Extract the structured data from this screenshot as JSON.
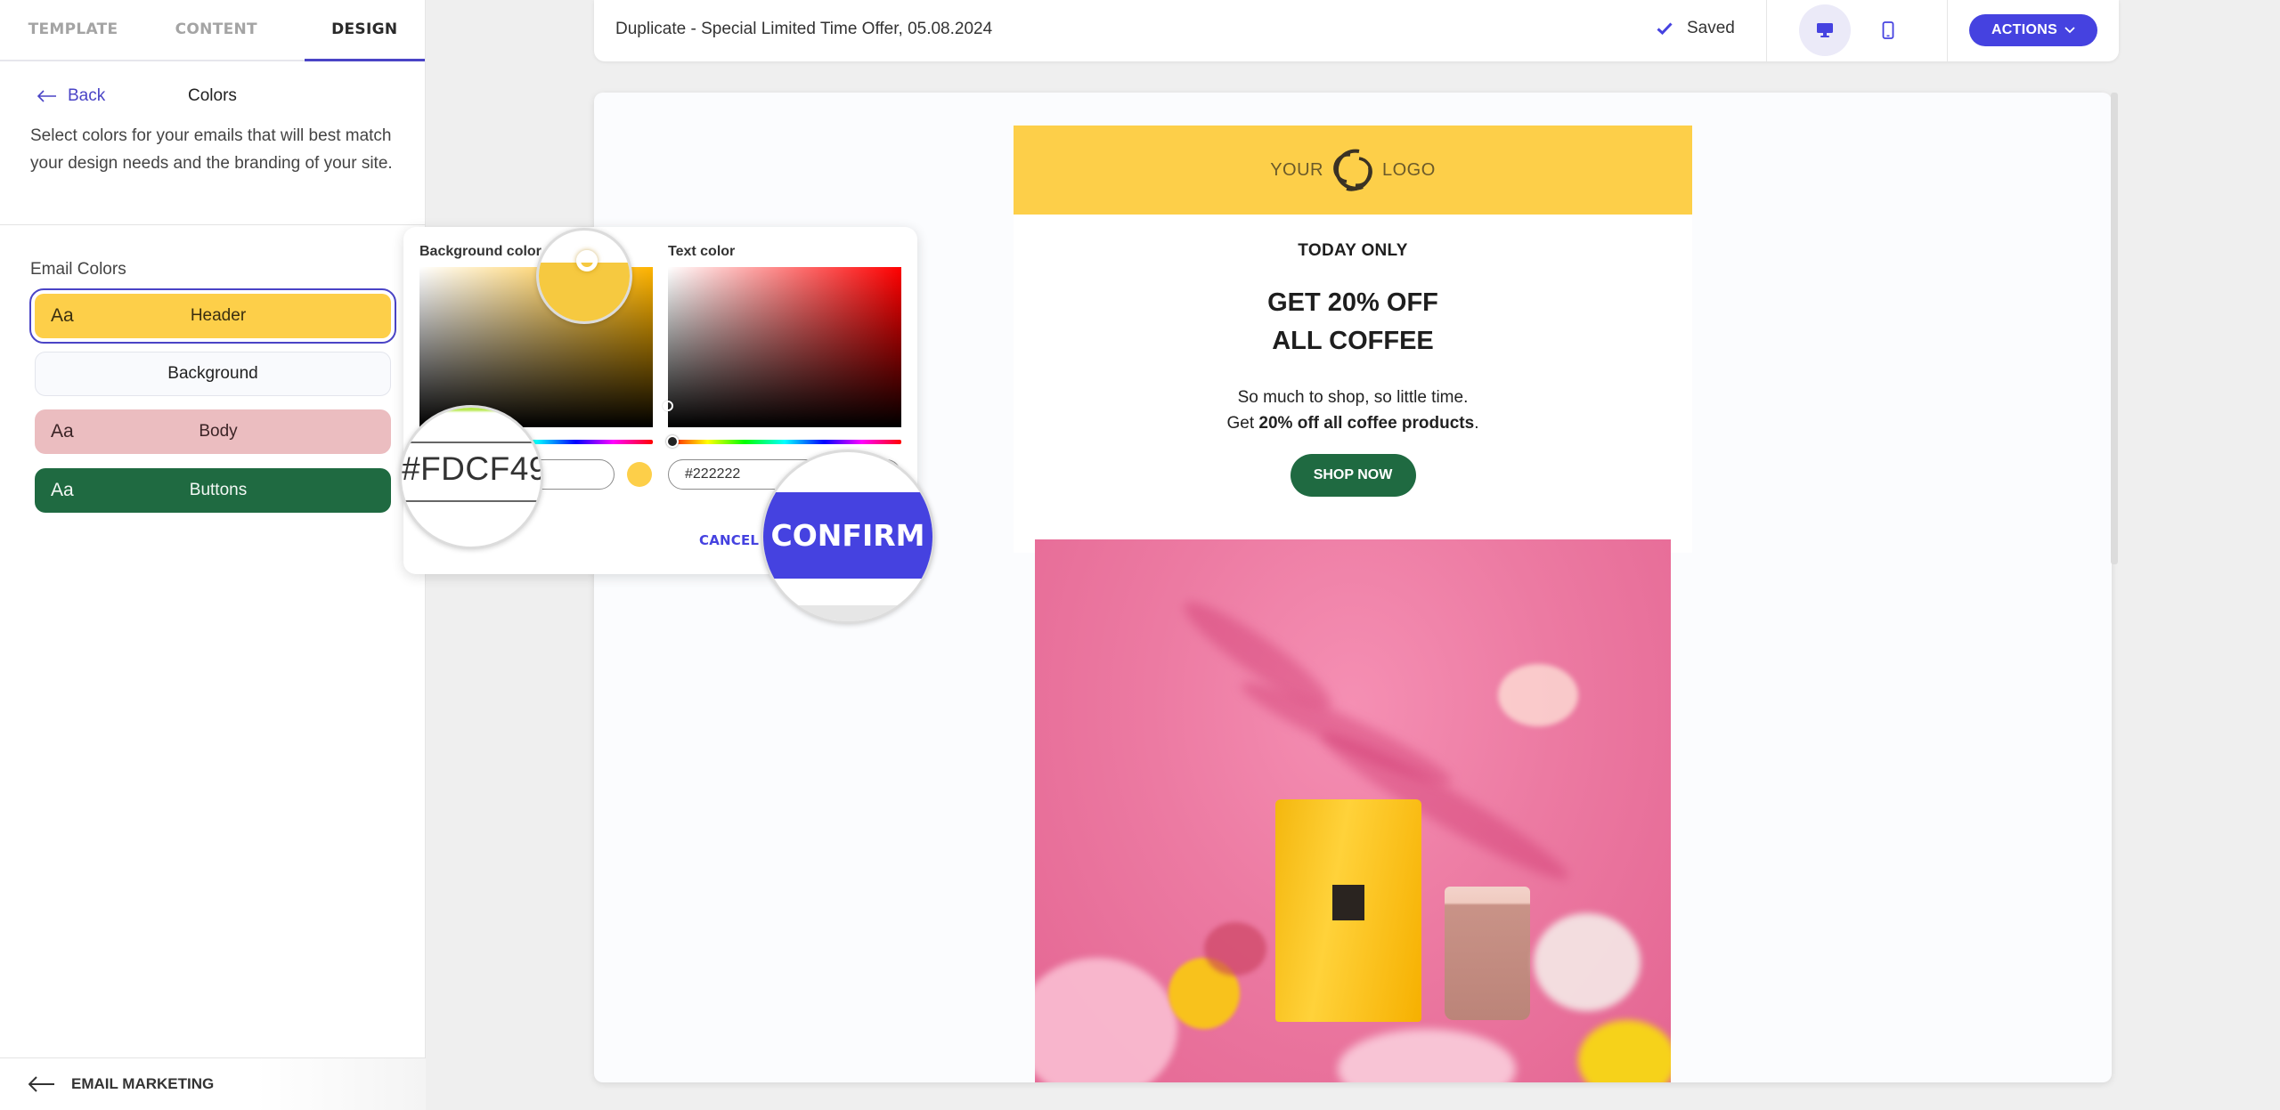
{
  "sidebar": {
    "tabs": [
      {
        "label": "TEMPLATE",
        "active": false
      },
      {
        "label": "CONTENT",
        "active": false
      },
      {
        "label": "DESIGN",
        "active": true
      }
    ],
    "back_label": "Back",
    "panel_title": "Colors",
    "description": "Select colors for your emails that will best match your design needs and the branding of your site.",
    "section_label": "Email Colors",
    "color_items": [
      {
        "aa": "Aa",
        "label": "Header",
        "color": "#FDCF49",
        "selected": true
      },
      {
        "aa": "",
        "label": "Background",
        "color": "#F9FAFD",
        "selected": false
      },
      {
        "aa": "Aa",
        "label": "Body",
        "color": "#EBBDC0",
        "selected": false
      },
      {
        "aa": "Aa",
        "label": "Buttons",
        "color": "#1F6A41",
        "selected": false
      }
    ],
    "footer_label": "EMAIL MARKETING"
  },
  "topbar": {
    "document_title": "Duplicate - Special Limited Time Offer, 05.08.2024",
    "save_status": "Saved",
    "device_modes": [
      {
        "name": "desktop",
        "active": true
      },
      {
        "name": "mobile",
        "active": false
      }
    ],
    "actions_label": "ACTIONS"
  },
  "color_picker": {
    "background": {
      "label": "Background color",
      "hex": "#FDCF49",
      "hue_color": "#FFB400"
    },
    "text": {
      "label": "Text color",
      "hex": "#222222",
      "hue_color": "#FF0000"
    },
    "cancel_label": "CANCEL",
    "confirm_label": "CONFIRM"
  },
  "email": {
    "logo_left": "YOUR",
    "logo_right": "LOGO",
    "eyebrow": "TODAY ONLY",
    "headline_line1": "GET 20% OFF",
    "headline_line2": "ALL COFFEE",
    "para_line1": "So much to shop, so little time.",
    "para_line2_prefix": "Get ",
    "para_line2_bold": "20% off all coffee products",
    "para_line2_suffix": ".",
    "cta_label": "SHOP NOW",
    "hero_alt": "Yellow coffee bag and latte on pink background with flowers"
  },
  "colors": {
    "accent": "#4542E0",
    "header": "#FDCF49",
    "body": "#EBBDC0",
    "buttons": "#1F6A41",
    "text": "#222222"
  }
}
